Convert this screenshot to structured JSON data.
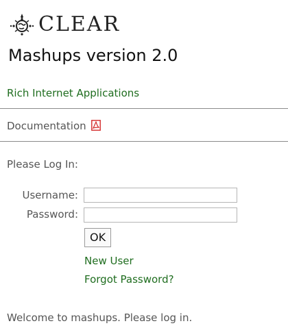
{
  "logo": {
    "wordmark": "CLEAR",
    "mark_icon": "globe-ornament-icon"
  },
  "app_title": "Mashups version 2.0",
  "nav": {
    "rich_apps_link": "Rich Internet Applications",
    "documentation_label": "Documentation",
    "documentation_icon": "pdf-icon"
  },
  "login": {
    "prompt": "Please Log In:",
    "username_label": "Username:",
    "username_value": "",
    "password_label": "Password:",
    "password_value": "",
    "ok_label": "OK",
    "new_user_link": "New User",
    "forgot_password_link": "Forgot Password?"
  },
  "status_message": "Welcome to mashups. Please log in.",
  "colors": {
    "link_green": "#1f6d1f",
    "pdf_red": "#d42b2b",
    "divider": "#8a8a8a"
  }
}
